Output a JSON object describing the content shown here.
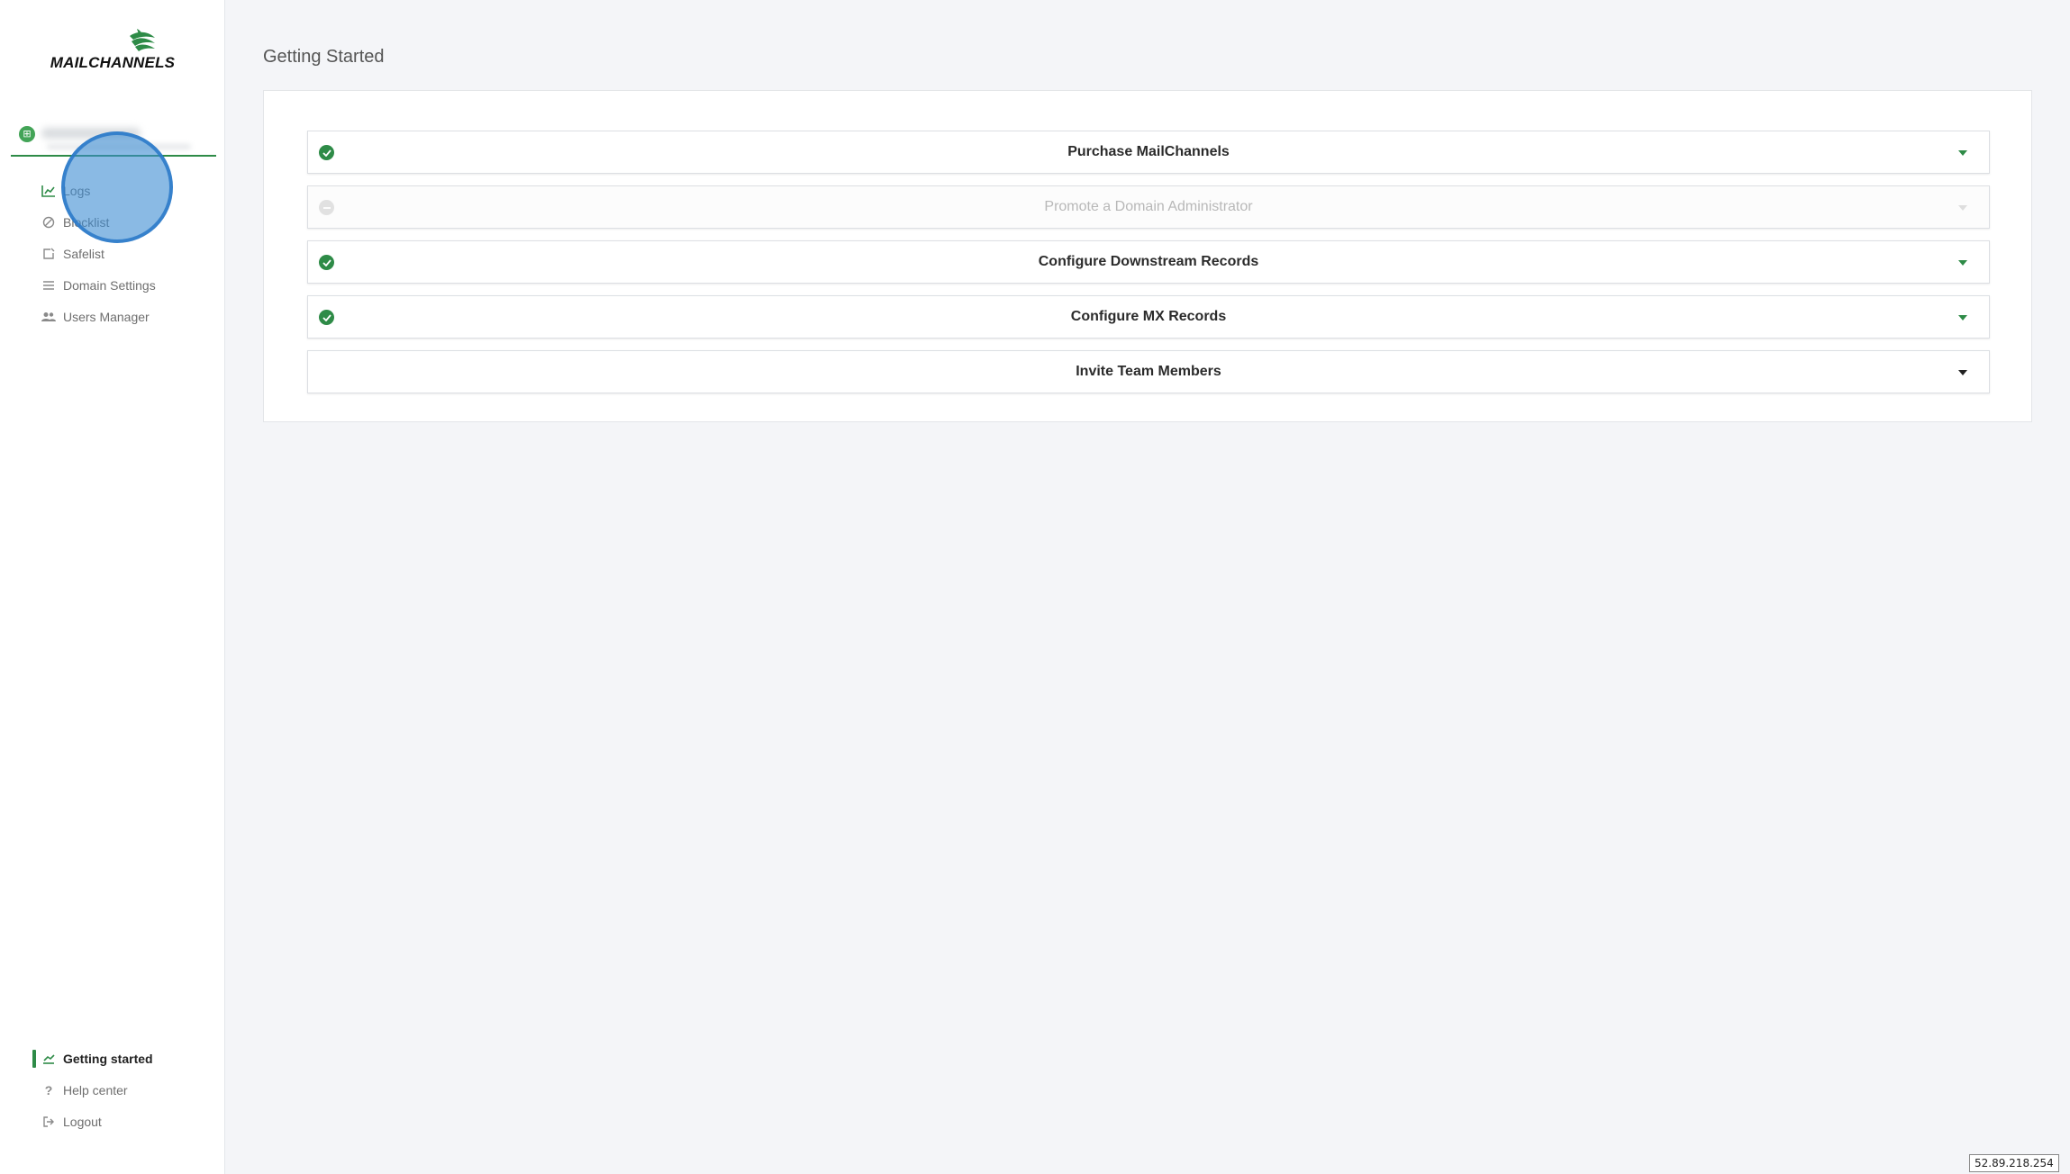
{
  "brand": {
    "name": "MAILCHANNELS",
    "accent": "#2e8b47"
  },
  "domain": {
    "name": "",
    "icon": "domain-grid-icon"
  },
  "nav": [
    {
      "label": "Logs",
      "icon": "logs-chart-icon"
    },
    {
      "label": "Blocklist",
      "icon": "block-circle-icon"
    },
    {
      "label": "Safelist",
      "icon": "safelist-square-icon"
    },
    {
      "label": "Domain Settings",
      "icon": "menu-lines-icon"
    },
    {
      "label": "Users Manager",
      "icon": "users-icon"
    }
  ],
  "bottom_nav": [
    {
      "label": "Getting started",
      "icon": "getting-started-icon",
      "active": true
    },
    {
      "label": "Help center",
      "icon": "question-icon"
    },
    {
      "label": "Logout",
      "icon": "logout-icon"
    }
  ],
  "page": {
    "title": "Getting Started"
  },
  "steps": [
    {
      "label": "Purchase MailChannels",
      "done": true,
      "disabled": false
    },
    {
      "label": "Promote a Domain Administrator",
      "done": false,
      "disabled": true
    },
    {
      "label": "Configure Downstream Records",
      "done": true,
      "disabled": false
    },
    {
      "label": "Configure MX Records",
      "done": true,
      "disabled": false
    },
    {
      "label": "Invite Team Members",
      "done": false,
      "disabled": false
    }
  ],
  "footer": {
    "ip": "52.89.218.254"
  }
}
